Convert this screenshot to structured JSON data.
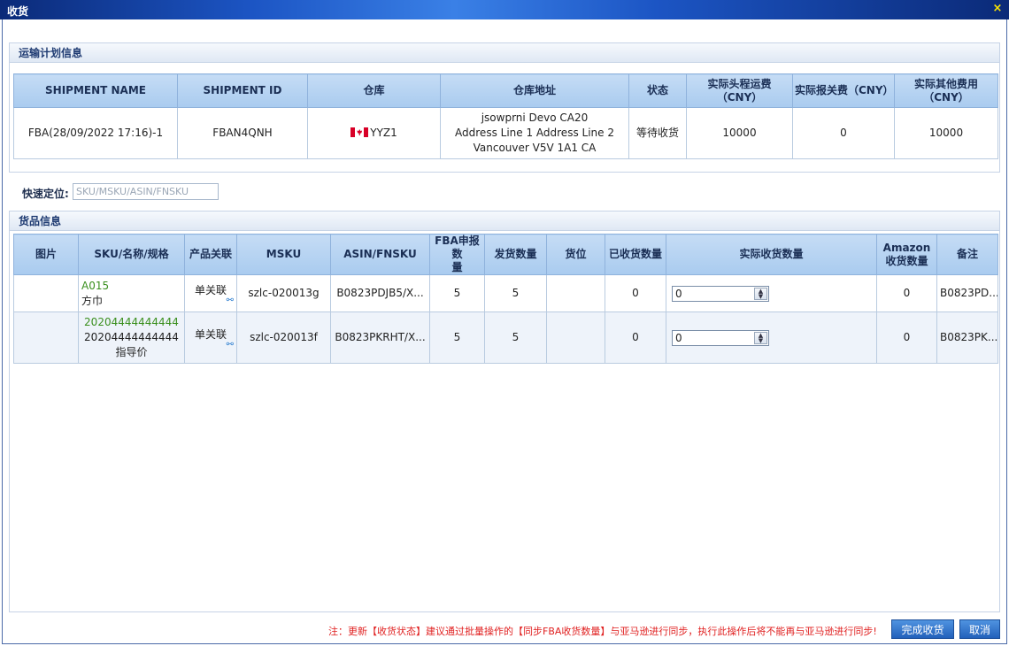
{
  "window": {
    "title": "收货",
    "close_icon": "×"
  },
  "shipment_panel": {
    "title": "运输计划信息",
    "columns": [
      "SHIPMENT NAME",
      "SHIPMENT ID",
      "仓库",
      "仓库地址",
      "状态",
      "实际头程运费\n（CNY）",
      "实际报关费（CNY）",
      "实际其他费用\n（CNY）"
    ],
    "row": {
      "shipment_name": "FBA(28/09/2022 17:16)-1",
      "shipment_id": "FBAN4QNH",
      "warehouse": "YYZ1",
      "warehouse_flag": "canada-flag-icon",
      "address_lines": [
        "jsowprni Devo CA20",
        "Address Line 1 Address Line 2",
        "Vancouver V5V 1A1 CA"
      ],
      "status": "等待收货",
      "freight": "10000",
      "customs_fee": "0",
      "other_fee": "10000"
    }
  },
  "quick_locate": {
    "label": "快速定位:",
    "placeholder": "SKU/MSKU/ASIN/FNSKU"
  },
  "goods_panel": {
    "title": "货品信息",
    "columns": [
      "图片",
      "SKU/名称/规格",
      "产品关联",
      "MSKU",
      "ASIN/FNSKU",
      "FBA申报数\n量",
      "发货数量",
      "货位",
      "已收货数量",
      "实际收货数量",
      "Amazon\n收货数量",
      "备注"
    ],
    "rows": [
      {
        "sku": "A015",
        "name": "方巾",
        "relation": "单关联",
        "msku": "szlc-020013g",
        "asin": "B0823PDJB5/X...",
        "fba_qty": "5",
        "ship_qty": "5",
        "location": "",
        "received": "0",
        "actual_received": "0",
        "amazon_received": "0",
        "note": "B0823PD..."
      },
      {
        "sku": "20204444444444",
        "name": "20204444444444指导价",
        "relation": "单关联",
        "msku": "szlc-020013f",
        "asin": "B0823PKRHT/X...",
        "fba_qty": "5",
        "ship_qty": "5",
        "location": "",
        "received": "0",
        "actual_received": "0",
        "amazon_received": "0",
        "note": "B0823PK..."
      }
    ]
  },
  "footer": {
    "note": "注：更新【收货状态】建议通过批量操作的【同步FBA收货数量】与亚马逊进行同步，执行此操作后将不能再与亚马逊进行同步!",
    "confirm_label": "完成收货",
    "cancel_label": "取消"
  },
  "colors": {
    "title_bar": "#1c55c4",
    "header_cell": "#b5d2f2",
    "green_text": "#3a8f1e",
    "warning_text": "#e02020",
    "button": "#2f6fcc"
  }
}
